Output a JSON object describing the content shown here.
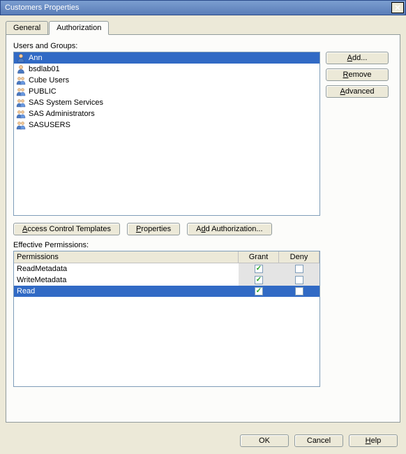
{
  "window": {
    "title": "Customers Properties"
  },
  "tabs": [
    {
      "label": "General",
      "active": false
    },
    {
      "label": "Authorization",
      "active": true
    }
  ],
  "usersGroups": {
    "label": "Users and Groups:",
    "items": [
      {
        "name": "Ann",
        "type": "user",
        "selected": true
      },
      {
        "name": "bsdlab01",
        "type": "user",
        "selected": false
      },
      {
        "name": "Cube Users",
        "type": "group",
        "selected": false
      },
      {
        "name": "PUBLIC",
        "type": "group",
        "selected": false
      },
      {
        "name": "SAS System Services",
        "type": "group",
        "selected": false
      },
      {
        "name": "SAS Administrators",
        "type": "group",
        "selected": false
      },
      {
        "name": "SASUSERS",
        "type": "group",
        "selected": false
      }
    ]
  },
  "sideButtons": {
    "add": "Add...",
    "remove": "Remove",
    "advanced": "Advanced"
  },
  "midButtons": {
    "act": "Access Control Templates",
    "properties": "Properties",
    "addAuth": "Add Authorization..."
  },
  "permissions": {
    "label": "Effective Permissions:",
    "headers": {
      "name": "Permissions",
      "grant": "Grant",
      "deny": "Deny"
    },
    "rows": [
      {
        "name": "ReadMetadata",
        "grant": true,
        "deny": false,
        "selected": false
      },
      {
        "name": "WriteMetadata",
        "grant": true,
        "deny": false,
        "selected": false
      },
      {
        "name": "Read",
        "grant": true,
        "deny": false,
        "selected": true
      }
    ]
  },
  "dialogButtons": {
    "ok": "OK",
    "cancel": "Cancel",
    "help": "Help"
  }
}
